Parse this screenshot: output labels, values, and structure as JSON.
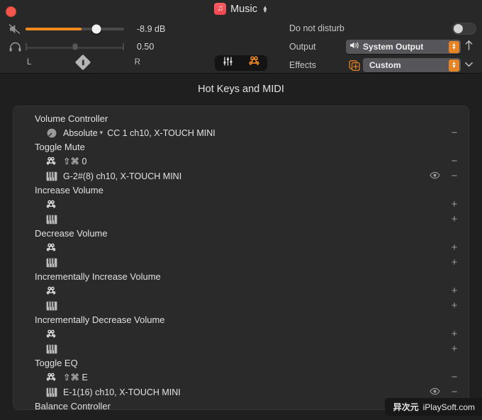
{
  "window": {
    "close_button_label": "Close",
    "app_title": "Music"
  },
  "volume": {
    "mute_icon": "speaker-mute-icon",
    "headphone_icon": "headphone-icon",
    "db_value": "-8.9 dB",
    "balance_value": "0.50",
    "left_label": "L",
    "right_label": "R",
    "fill_percent": 57,
    "knob_percent": 72,
    "balance_percent": 50
  },
  "mode_pill": {
    "sliders_icon": "equalizer-sliders-icon",
    "command_icon": "command-key-icon"
  },
  "settings": {
    "dnd_label": "Do not disturb",
    "dnd_on": false,
    "output_label": "Output",
    "output_value": "System Output",
    "effects_label": "Effects",
    "effects_value": "Custom"
  },
  "main": {
    "section_title": "Hot Keys and MIDI",
    "groups": [
      {
        "title": "Volume Controller",
        "rows": [
          {
            "icon": "knob-icon",
            "mode": "Absolute",
            "has_mode_chevron": true,
            "text": "CC 1 ch10, X-TOUCH MINI",
            "eye": false,
            "action": "−"
          }
        ]
      },
      {
        "title": "Toggle Mute",
        "rows": [
          {
            "icon": "command-key-icon",
            "text": "⇧⌘ 0",
            "eye": false,
            "action": "−"
          },
          {
            "icon": "piano-keys-icon",
            "text": "G-2#(8) ch10, X-TOUCH MINI",
            "eye": true,
            "action": "−"
          }
        ]
      },
      {
        "title": "Increase Volume",
        "rows": [
          {
            "icon": "command-key-icon",
            "text": "",
            "eye": false,
            "action": "+"
          },
          {
            "icon": "piano-keys-icon",
            "text": "",
            "eye": false,
            "action": "+"
          }
        ]
      },
      {
        "title": "Decrease Volume",
        "rows": [
          {
            "icon": "command-key-icon",
            "text": "",
            "eye": false,
            "action": "+"
          },
          {
            "icon": "piano-keys-icon",
            "text": "",
            "eye": false,
            "action": "+"
          }
        ]
      },
      {
        "title": "Incrementally Increase Volume",
        "rows": [
          {
            "icon": "command-key-icon",
            "text": "",
            "eye": false,
            "action": "+"
          },
          {
            "icon": "piano-keys-icon",
            "text": "",
            "eye": false,
            "action": "+"
          }
        ]
      },
      {
        "title": "Incrementally Decrease Volume",
        "rows": [
          {
            "icon": "command-key-icon",
            "text": "",
            "eye": false,
            "action": "+"
          },
          {
            "icon": "piano-keys-icon",
            "text": "",
            "eye": false,
            "action": "+"
          }
        ]
      },
      {
        "title": "Toggle EQ",
        "rows": [
          {
            "icon": "command-key-icon",
            "text": "⇧⌘ E",
            "eye": false,
            "action": "−"
          },
          {
            "icon": "piano-keys-icon",
            "text": "E-1(16) ch10, X-TOUCH MINI",
            "eye": true,
            "action": "−"
          }
        ]
      },
      {
        "title": "Balance Controller",
        "rows": []
      }
    ]
  },
  "watermark": {
    "cn": "异次元",
    "en": "iPlaySoft.com"
  },
  "colors": {
    "accent_orange": "#f08a1e",
    "stepper_orange": "#e58325",
    "window_bg": "#1f1f1f",
    "topbar_bg": "#282828",
    "card_bg": "#2a2a2a",
    "close_red": "#f4564a"
  }
}
